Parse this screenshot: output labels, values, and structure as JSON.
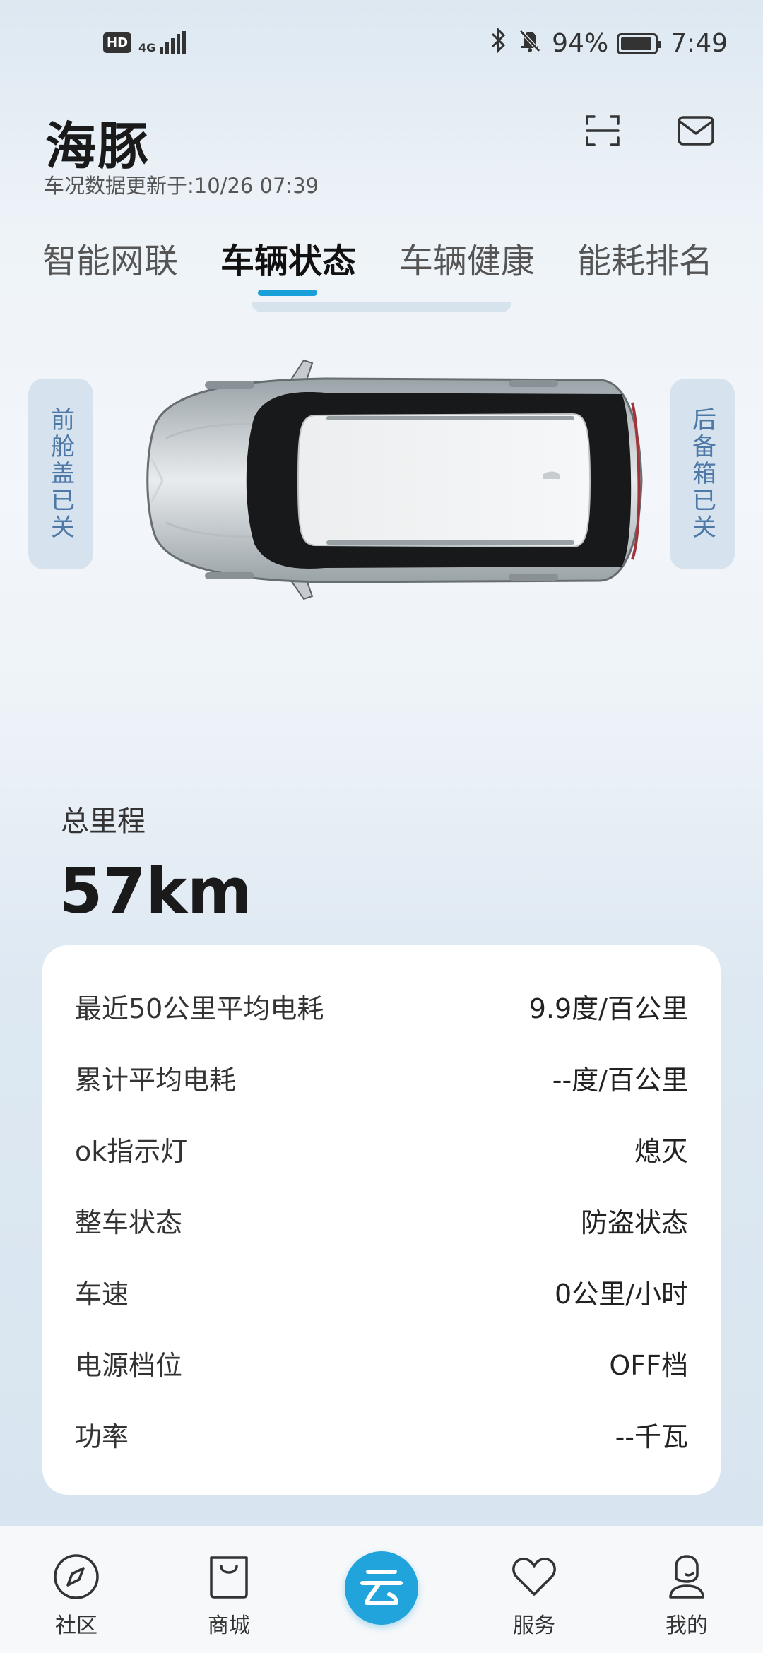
{
  "status_bar": {
    "left_badge": "HD",
    "network": "4G",
    "battery_percent": "94%",
    "time": "7:49"
  },
  "header": {
    "title": "海豚",
    "update_text": "车况数据更新于:10/26 07:39"
  },
  "tabs": [
    {
      "label": "智能网联",
      "active": false
    },
    {
      "label": "车辆状态",
      "active": true
    },
    {
      "label": "车辆健康",
      "active": false
    },
    {
      "label": "能耗排名",
      "active": false
    }
  ],
  "car_status": {
    "front_hood": "前舱盖已关",
    "trunk": "后备箱已关"
  },
  "mileage": {
    "label": "总里程",
    "value": "57km"
  },
  "stats": [
    {
      "label": "最近50公里平均电耗",
      "value": "9.9度/百公里"
    },
    {
      "label": "累计平均电耗",
      "value": "--度/百公里"
    },
    {
      "label": "ok指示灯",
      "value": "熄灭"
    },
    {
      "label": "整车状态",
      "value": "防盗状态"
    },
    {
      "label": "车速",
      "value": "0公里/小时"
    },
    {
      "label": "电源档位",
      "value": "OFF档"
    },
    {
      "label": "功率",
      "value": "--千瓦"
    }
  ],
  "bottom_nav": [
    {
      "label": "社区",
      "icon": "compass-icon"
    },
    {
      "label": "商城",
      "icon": "bag-icon"
    },
    {
      "label": "",
      "icon": "cloud-logo-icon"
    },
    {
      "label": "服务",
      "icon": "heart-icon"
    },
    {
      "label": "我的",
      "icon": "person-icon"
    }
  ],
  "colors": {
    "accent": "#1aa0d8",
    "pill_bg": "#d6e3ee",
    "pill_text": "#4e79a6"
  }
}
